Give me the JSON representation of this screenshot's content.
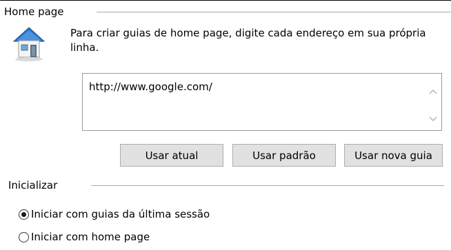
{
  "home_page": {
    "group_title": "Home page",
    "description": "Para criar guias de home page, digite cada endereço em sua própria linha.",
    "url_value": "http://www.google.com/",
    "buttons": {
      "use_current": "Usar atual",
      "use_default": "Usar padrão",
      "use_new_tab": "Usar nova guia"
    }
  },
  "startup": {
    "group_title": "Inicializar",
    "options": [
      {
        "label": "Iniciar com guias da última sessão",
        "selected": true
      },
      {
        "label": "Iniciar com home page",
        "selected": false
      }
    ]
  },
  "icons": {
    "house": "house-icon",
    "scroll_up": "chevron-up-icon",
    "scroll_down": "chevron-down-icon"
  },
  "colors": {
    "button_bg": "#e1e1e1",
    "roof_blue": "#2a74c9"
  }
}
